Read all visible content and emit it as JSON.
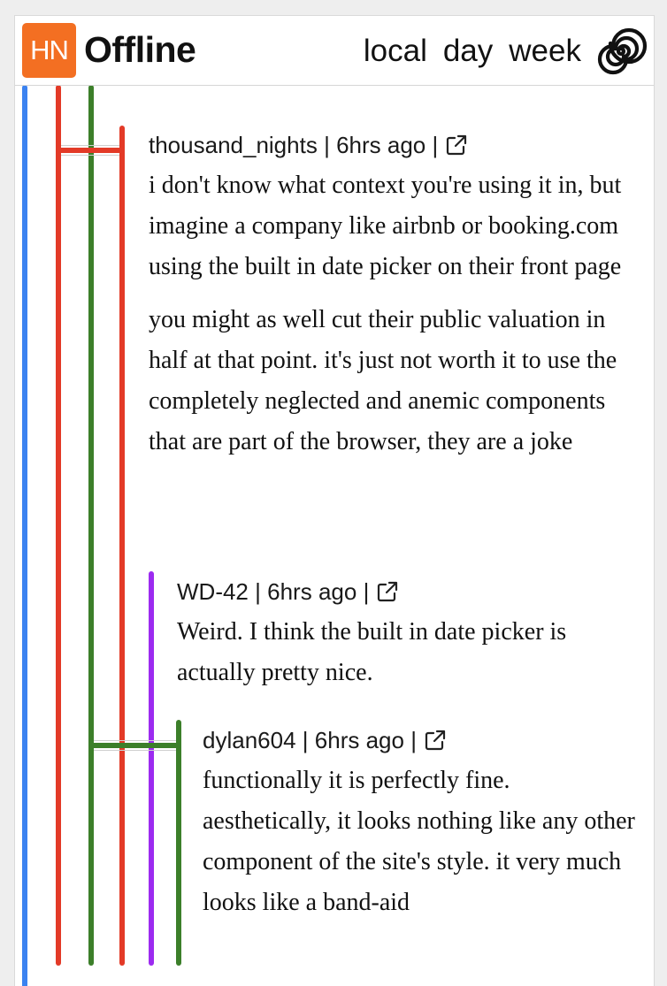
{
  "header": {
    "logo_text": "HN",
    "brand": "Offline",
    "nav": [
      "local",
      "day",
      "week"
    ],
    "menu_icon": "spiral-icon"
  },
  "colors": {
    "logo_bg": "#f36f22",
    "thread_blue": "#3b82f0",
    "thread_red": "#e33a27",
    "thread_green": "#3c7f2a",
    "thread_purple": "#9c2bf0"
  },
  "clipped_text": "- - - - - - - - -",
  "comments": [
    {
      "author": "thousand_nights",
      "separator": "|",
      "age": "6hrs ago",
      "separator2": "|",
      "link_icon": "external-link-icon",
      "paragraphs": [
        "i don't know what context you're using it in, but imagine a company like airbnb or booking.com using the built in date picker on their front page",
        "you might as well cut their public valuation in half at that point. it's just not worth it to use the completely neglected and anemic components that are part of the browser, they are a joke"
      ]
    },
    {
      "author": "WD-42",
      "separator": "|",
      "age": "6hrs ago",
      "separator2": "|",
      "link_icon": "external-link-icon",
      "paragraphs": [
        "Weird. I think the built in date picker is actually pretty nice."
      ]
    },
    {
      "author": "dylan604",
      "separator": "|",
      "age": "6hrs ago",
      "separator2": "|",
      "link_icon": "external-link-icon",
      "paragraphs": [
        "functionally it is perfectly fine. aesthetically, it looks nothing like any other component of the site's style. it very much looks like a band-aid"
      ]
    }
  ]
}
